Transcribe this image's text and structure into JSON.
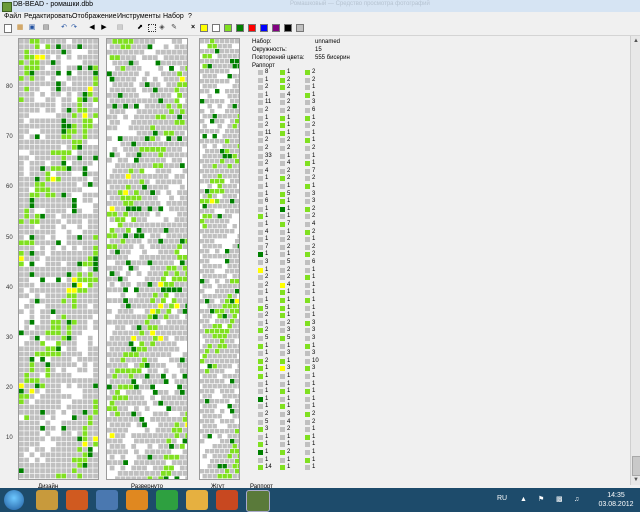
{
  "window": {
    "title": "DB-BEAD - ромашки.dbb",
    "faded_title": "Ромашковый — Средство просмотра фотографий"
  },
  "menu": [
    "Файл",
    "Редактировать",
    "Отображение",
    "Инструменты",
    "Набор",
    "?"
  ],
  "palette": [
    "#ffffff",
    "#ffff00",
    "#ffffff",
    "#80e020",
    "#008000",
    "#ff0000",
    "#0000ff",
    "#800080",
    "#000000",
    "#c0c0c0"
  ],
  "info": {
    "set_label": "Набор:",
    "set_value": "unnamed",
    "circ_label": "Окружность:",
    "circ_value": "15",
    "repeat_label": "Повторений цвета:",
    "repeat_value": "555 бисерин",
    "rapport_label": "Раппорт"
  },
  "ruler_ticks": [
    "80",
    "70",
    "60",
    "50",
    "40",
    "30",
    "20",
    "10"
  ],
  "tabs": {
    "design": "Дизайн",
    "unrolled": "Развернуто",
    "rope": "Жгут",
    "rapport": "Раппорт"
  },
  "colors": {
    "gray": "#c0c0c0",
    "white": "#ffffff",
    "lime": "#80e020",
    "green": "#008000",
    "yellow": "#ffff00"
  },
  "rapport": [
    {
      "col": 0,
      "entries": [
        [
          "g",
          "8"
        ],
        [
          "g",
          "1"
        ],
        [
          "g",
          "2"
        ],
        [
          "g",
          "1"
        ],
        [
          "g",
          "11"
        ],
        [
          "g",
          "2"
        ],
        [
          "g",
          "1"
        ],
        [
          "g",
          "2"
        ],
        [
          "g",
          "11"
        ],
        [
          "g",
          "2"
        ],
        [
          "g",
          "2"
        ],
        [
          "g",
          "33"
        ],
        [
          "g",
          "2"
        ],
        [
          "g",
          "4"
        ],
        [
          "g",
          "1"
        ],
        [
          "g",
          "1"
        ],
        [
          "g",
          "1"
        ],
        [
          "g",
          "6"
        ],
        [
          "g",
          "1"
        ],
        [
          "l",
          "1"
        ],
        [
          "g",
          "1"
        ],
        [
          "g",
          "4"
        ],
        [
          "g",
          "1"
        ],
        [
          "g",
          "7"
        ],
        [
          "d",
          "1"
        ],
        [
          "g",
          "3"
        ],
        [
          "y",
          "1"
        ],
        [
          "g",
          "2"
        ],
        [
          "g",
          "2"
        ],
        [
          "g",
          "1"
        ],
        [
          "g",
          "1"
        ],
        [
          "l",
          "5"
        ],
        [
          "g",
          "2"
        ],
        [
          "g",
          "1"
        ],
        [
          "l",
          "2"
        ],
        [
          "g",
          "5"
        ],
        [
          "l",
          "1"
        ],
        [
          "g",
          "1"
        ],
        [
          "l",
          "2"
        ],
        [
          "l",
          "1"
        ],
        [
          "l",
          "1"
        ],
        [
          "g",
          "1"
        ],
        [
          "g",
          "1"
        ],
        [
          "d",
          "1"
        ],
        [
          "g",
          "1"
        ],
        [
          "g",
          "2"
        ],
        [
          "g",
          "5"
        ],
        [
          "l",
          "3"
        ],
        [
          "g",
          "1"
        ],
        [
          "l",
          "1"
        ],
        [
          "d",
          "1"
        ],
        [
          "g",
          "1"
        ],
        [
          "l",
          "14"
        ]
      ]
    },
    {
      "col": 1,
      "entries": [
        [
          "l",
          "1"
        ],
        [
          "l",
          "2"
        ],
        [
          "l",
          "2"
        ],
        [
          "g",
          "4"
        ],
        [
          "g",
          "2"
        ],
        [
          "g",
          "2"
        ],
        [
          "l",
          "1"
        ],
        [
          "l",
          "1"
        ],
        [
          "l",
          "1"
        ],
        [
          "g",
          "2"
        ],
        [
          "g",
          "2"
        ],
        [
          "g",
          "1"
        ],
        [
          "g",
          "4"
        ],
        [
          "g",
          "2"
        ],
        [
          "l",
          "2"
        ],
        [
          "g",
          "1"
        ],
        [
          "l",
          "5"
        ],
        [
          "l",
          "1"
        ],
        [
          "d",
          "1"
        ],
        [
          "g",
          "1"
        ],
        [
          "l",
          "7"
        ],
        [
          "g",
          "1"
        ],
        [
          "g",
          "2"
        ],
        [
          "g",
          "2"
        ],
        [
          "g",
          "1"
        ],
        [
          "g",
          "5"
        ],
        [
          "g",
          "2"
        ],
        [
          "g",
          "2"
        ],
        [
          "y",
          "4"
        ],
        [
          "l",
          "1"
        ],
        [
          "l",
          "1"
        ],
        [
          "l",
          "1"
        ],
        [
          "l",
          "1"
        ],
        [
          "g",
          "2"
        ],
        [
          "g",
          "3"
        ],
        [
          "l",
          "5"
        ],
        [
          "g",
          "1"
        ],
        [
          "g",
          "3"
        ],
        [
          "l",
          "1"
        ],
        [
          "y",
          "3"
        ],
        [
          "g",
          "1"
        ],
        [
          "g",
          "1"
        ],
        [
          "l",
          "1"
        ],
        [
          "g",
          "1"
        ],
        [
          "l",
          "1"
        ],
        [
          "g",
          "3"
        ],
        [
          "g",
          "4"
        ],
        [
          "g",
          "2"
        ],
        [
          "g",
          "1"
        ],
        [
          "g",
          "1"
        ],
        [
          "l",
          "2"
        ],
        [
          "g",
          "1"
        ],
        [
          "l",
          "1"
        ]
      ]
    }
  ]
}
